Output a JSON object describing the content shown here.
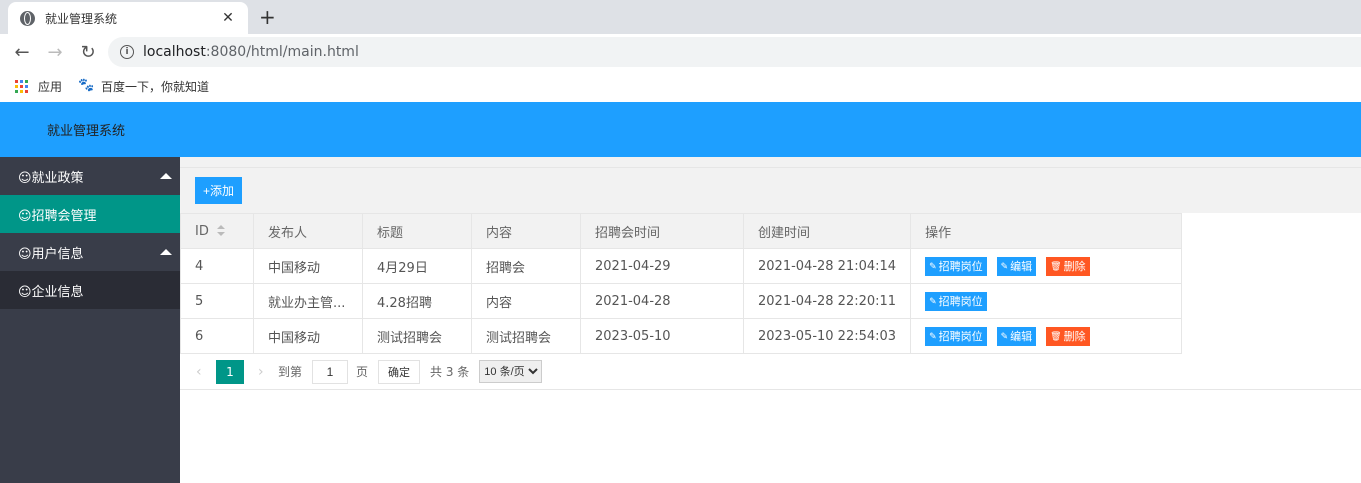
{
  "browser": {
    "tab_title": "就业管理系统",
    "tab_close": "✕",
    "new_tab": "+",
    "url_host": "localhost",
    "url_rest": ":8080/html/main.html",
    "bookmarks": [
      {
        "label": "应用",
        "icon": "apps-grid-icon"
      },
      {
        "label": "百度一下，你就知道",
        "icon": "baidu-paw-icon"
      }
    ]
  },
  "app": {
    "title": "就业管理系统"
  },
  "sidebar": {
    "groups": [
      {
        "label": "☺就业政策",
        "expanded": true
      },
      {
        "label": "☺招聘会管理",
        "active": true
      },
      {
        "label": "☺用户信息",
        "expanded": true
      },
      {
        "label": "☺企业信息"
      }
    ]
  },
  "toolbar": {
    "add_label": "+添加"
  },
  "table": {
    "columns": [
      "ID",
      "发布人",
      "标题",
      "内容",
      "招聘会时间",
      "创建时间",
      "操作"
    ],
    "rows": [
      {
        "id": "4",
        "publisher": "中国移动",
        "title": "4月29日",
        "content": "招聘会",
        "fair_time": "2021-04-29",
        "created": "2021-04-28 21:04:14",
        "actions": [
          "招聘岗位",
          "编辑",
          "删除"
        ]
      },
      {
        "id": "5",
        "publisher": "就业办主管...",
        "title": "4.28招聘",
        "content": "内容",
        "fair_time": "2021-04-28",
        "created": "2021-04-28 22:20:11",
        "actions": [
          "招聘岗位"
        ]
      },
      {
        "id": "6",
        "publisher": "中国移动",
        "title": "测试招聘会",
        "content": "测试招聘会",
        "fair_time": "2023-05-10",
        "created": "2023-05-10 22:54:03",
        "actions": [
          "招聘岗位",
          "编辑",
          "删除"
        ]
      }
    ]
  },
  "pager": {
    "prev": "‹",
    "current_page": "1",
    "next": "›",
    "goto_label": "到第",
    "goto_value": "1",
    "page_unit": "页",
    "confirm_label": "确定",
    "total_label": "共 3 条",
    "page_size": "10 条/页"
  },
  "colors": {
    "header_blue": "#1e9fff",
    "sidebar_bg": "#393d49",
    "active_teal": "#009688",
    "danger_orange": "#ff5722"
  }
}
